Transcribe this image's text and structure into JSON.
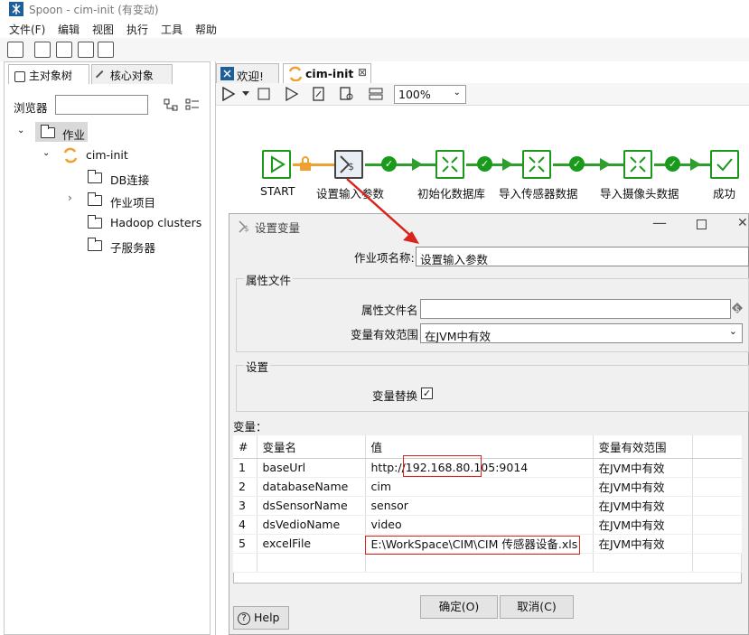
{
  "window": {
    "title": "Spoon - cim-init (有变动)"
  },
  "menu": [
    "文件(F)",
    "编辑",
    "视图",
    "执行",
    "工具",
    "帮助"
  ],
  "left_tabs": [
    "主对象树",
    "核心对象"
  ],
  "browser": {
    "label": "浏览器",
    "search_value": ""
  },
  "tree": {
    "root": "作业",
    "job": "cim-init",
    "children": [
      "DB连接",
      "作业项目",
      "Hadoop clusters",
      "子服务器"
    ]
  },
  "editor_tabs": [
    "欢迎!",
    "cim-init"
  ],
  "zoom": "100%",
  "workflow": {
    "nodes": [
      "START",
      "设置输入参数",
      "初始化数据库",
      "导入传感器数据",
      "导入摄像头数据",
      "成功"
    ]
  },
  "dialog": {
    "title": "设置变量",
    "job_name_label": "作业项名称:",
    "job_name_value": "设置输入参数",
    "props_legend": "属性文件",
    "props_file_label": "属性文件名",
    "props_file_value": "",
    "scope_label": "变量有效范围",
    "scope_value": "在JVM中有效",
    "settings_legend": "设置",
    "replace_label": "变量替换",
    "replace_checked": true,
    "vars_label": "变量：",
    "columns": [
      "#",
      "变量名",
      "值",
      "变量有效范围"
    ],
    "rows": [
      {
        "n": "1",
        "name": "baseUrl",
        "value_pre": "http://",
        "value_hl": "192.168.80.105",
        "value_post": ":9014",
        "scope": "在JVM中有效"
      },
      {
        "n": "2",
        "name": "databaseName",
        "value_pre": "cim",
        "value_hl": "",
        "value_post": "",
        "scope": "在JVM中有效"
      },
      {
        "n": "3",
        "name": "dsSensorName",
        "value_pre": "sensor",
        "value_hl": "",
        "value_post": "",
        "scope": "在JVM中有效"
      },
      {
        "n": "4",
        "name": "dsVedioName",
        "value_pre": "video",
        "value_hl": "",
        "value_post": "",
        "scope": "在JVM中有效"
      },
      {
        "n": "5",
        "name": "excelFile",
        "value_pre": "",
        "value_hl": "E:\\WorkSpace\\CIM\\CIM 传感器设备.xls",
        "value_post": "",
        "scope": "在JVM中有效"
      }
    ],
    "ok": "确定(O)",
    "cancel": "取消(C)",
    "help": "Help"
  },
  "colors": {
    "hop_green": "#2e9e2e",
    "annotation_red": "#d9241c",
    "orange": "#f0a030"
  }
}
